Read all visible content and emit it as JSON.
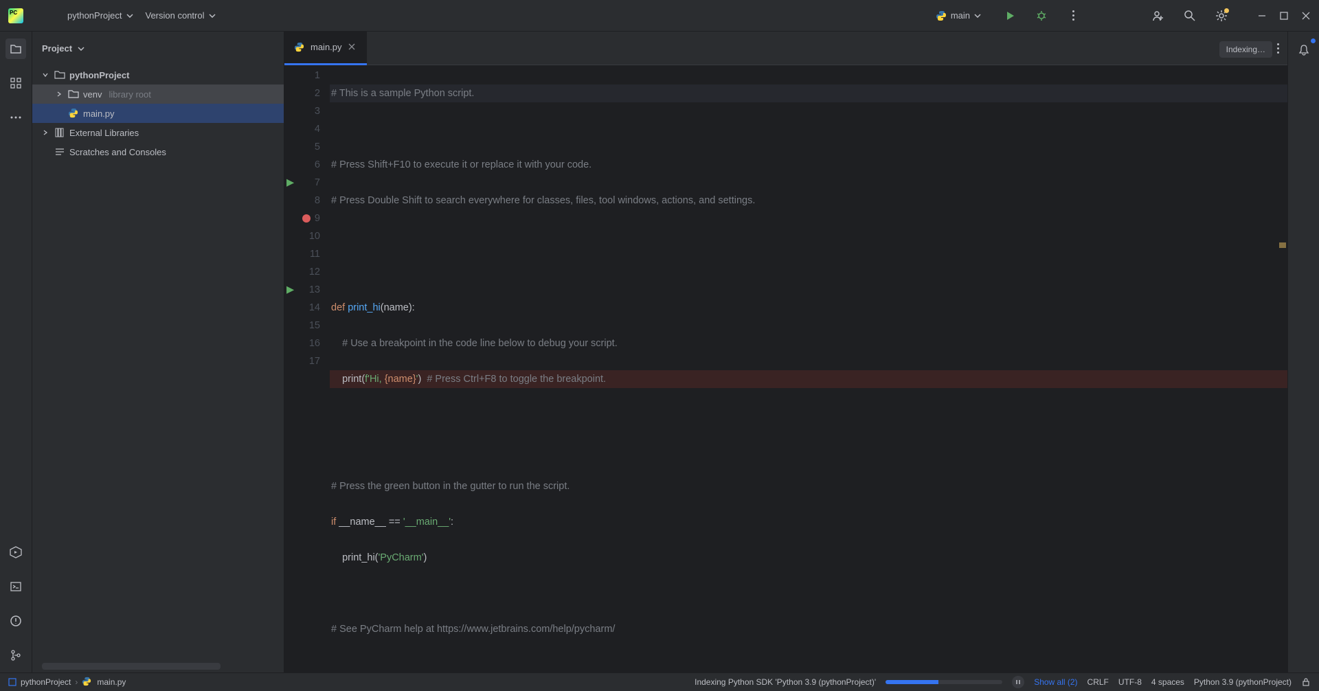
{
  "toolbar": {
    "project_name": "pythonProject",
    "vcs_label": "Version control",
    "run_config": "main"
  },
  "project_panel": {
    "title": "Project",
    "tree": {
      "root": "pythonProject",
      "venv": "venv",
      "venv_hint": "library root",
      "main": "main.py",
      "ext_libs": "External Libraries",
      "scratches": "Scratches and Consoles"
    }
  },
  "tabs": {
    "active": "main.py"
  },
  "indexing_badge": "Indexing…",
  "gutter": {
    "lines": [
      "1",
      "2",
      "3",
      "4",
      "5",
      "6",
      "7",
      "8",
      "9",
      "10",
      "11",
      "12",
      "13",
      "14",
      "15",
      "16",
      "17"
    ],
    "breakpoint_line": 9
  },
  "code": {
    "l1": "# This is a sample Python script.",
    "l3": "# Press Shift+F10 to execute it or replace it with your code.",
    "l4": "# Press Double Shift to search everywhere for classes, files, tool windows, actions, and settings.",
    "l7_def": "def ",
    "l7_fn": "print_hi",
    "l7_rest": "(name):",
    "l8": "    # Use a breakpoint in the code line below to debug your script.",
    "l9_a": "    print(",
    "l9_b": "f'Hi, ",
    "l9_c": "{name}",
    "l9_d": "'",
    "l9_e": ")  ",
    "l9_f": "# Press Ctrl+F8 to toggle the breakpoint.",
    "l12": "# Press the green button in the gutter to run the script.",
    "l13_if": "if ",
    "l13_name": "__name__ ",
    "l13_eq": "== ",
    "l13_str": "'__main__'",
    "l13_colon": ":",
    "l14_a": "    print_hi(",
    "l14_b": "'PyCharm'",
    "l14_c": ")",
    "l16": "# See PyCharm help at https://www.jetbrains.com/help/pycharm/"
  },
  "status": {
    "crumb_project": "pythonProject",
    "crumb_file": "main.py",
    "indexing": "Indexing Python SDK 'Python 3.9 (pythonProject)'",
    "show_all": "Show all (2)",
    "line_sep": "CRLF",
    "encoding": "UTF-8",
    "indent": "4 spaces",
    "interpreter": "Python 3.9 (pythonProject)"
  }
}
